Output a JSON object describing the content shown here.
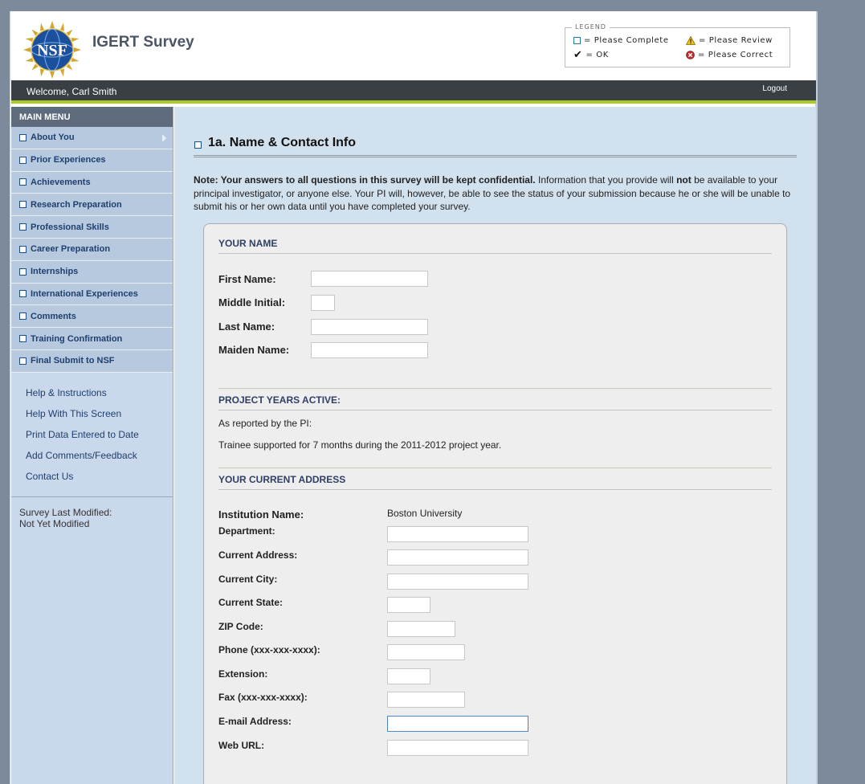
{
  "header": {
    "app_title": "IGERT Survey",
    "logo_text": "NSF",
    "legend": {
      "title": "LEGEND",
      "please_complete": "= Please Complete",
      "please_review": "= Please Review",
      "ok": "= OK",
      "please_correct": "= Please Correct"
    }
  },
  "topbar": {
    "welcome": "Welcome, Carl Smith",
    "logout": "Logout",
    "accent_color": "#a9cc2b"
  },
  "sidebar": {
    "menu_title": "MAIN MENU",
    "items": [
      {
        "label": "About You"
      },
      {
        "label": "Prior Experiences"
      },
      {
        "label": "Achievements"
      },
      {
        "label": "Research Preparation"
      },
      {
        "label": "Professional Skills"
      },
      {
        "label": "Career Preparation"
      },
      {
        "label": "Internships"
      },
      {
        "label": "International Experiences"
      },
      {
        "label": "Comments"
      },
      {
        "label": "Training Confirmation"
      },
      {
        "label": "Final Submit to NSF"
      }
    ],
    "links": [
      {
        "label": "Help & Instructions"
      },
      {
        "label": "Help With This Screen"
      },
      {
        "label": "Print Data Entered to Date"
      },
      {
        "label": "Add Comments/Feedback"
      },
      {
        "label": "Contact Us"
      }
    ],
    "modified_label": "Survey Last Modified:",
    "modified_value": "Not Yet Modified"
  },
  "main": {
    "page_title": "1a. Name & Contact Info",
    "note_bold": "Note: Your answers to all questions in this survey will be kept confidential.",
    "note_part1": " Information that you provide will ",
    "note_not": "not",
    "note_part2": " be available to your principal investigator, or anyone else. Your PI will, however, be able to see the status of your submission because he or she will be unable to submit his or her own data until you have completed your survey.",
    "your_name": {
      "heading": "YOUR NAME",
      "first_name": "First Name:",
      "middle_initial": "Middle Initial:",
      "last_name": "Last Name:",
      "maiden_name": "Maiden Name:"
    },
    "project_years": {
      "heading": "PROJECT YEARS ACTIVE:",
      "reported": "As reported by the PI:",
      "detail": "Trainee supported for 7 months during the 2011-2012 project year."
    },
    "address": {
      "heading": "YOUR CURRENT ADDRESS",
      "institution_label": "Institution Name:",
      "institution_value": "Boston University",
      "department": "Department:",
      "current_address": "Current Address:",
      "current_city": "Current City:",
      "current_state": "Current State:",
      "zip": "ZIP Code:",
      "phone": "Phone (xxx-xxx-xxxx):",
      "extension": "Extension:",
      "fax": "Fax (xxx-xxx-xxxx):",
      "email": "E-mail Address:",
      "web_url": "Web URL:"
    }
  }
}
